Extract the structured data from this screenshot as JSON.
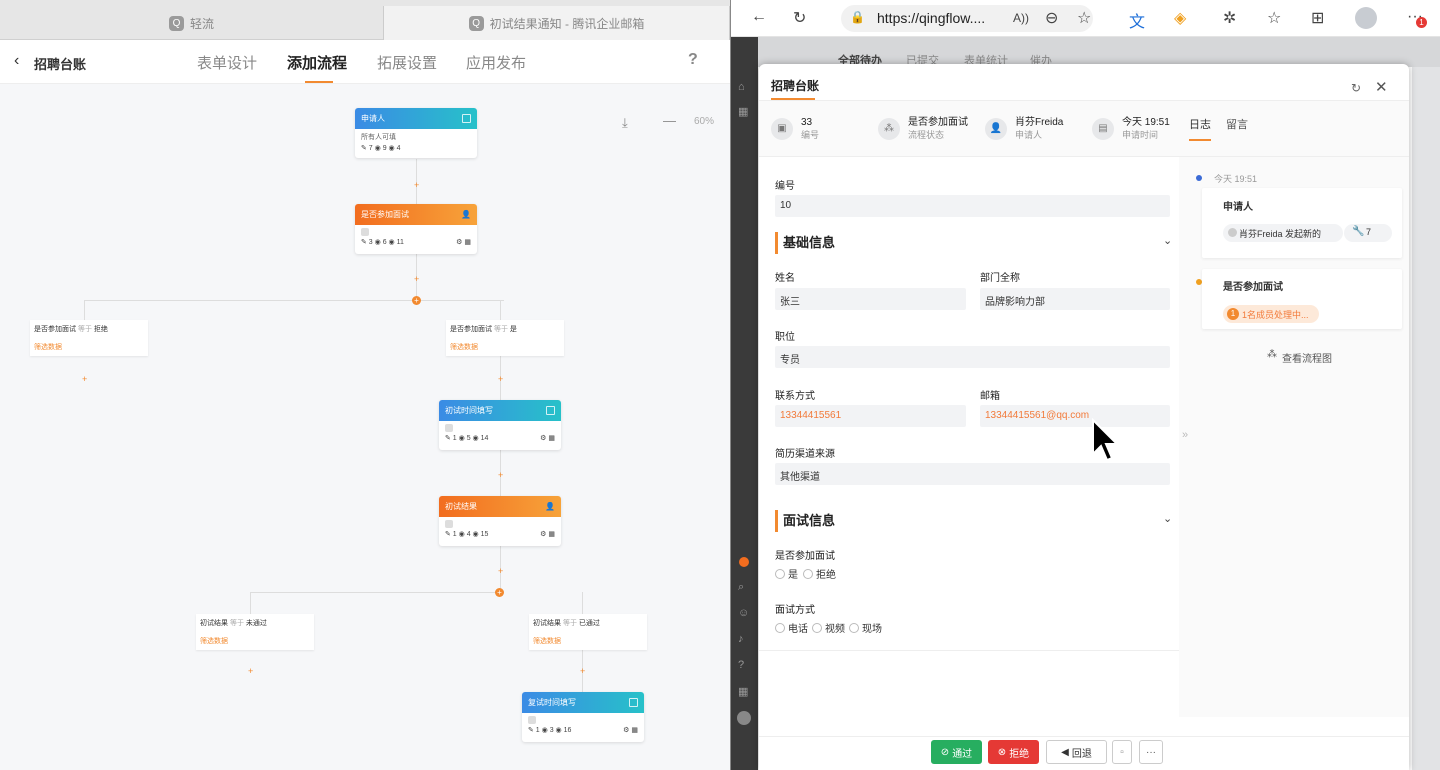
{
  "left_window": {
    "browser_tabs": [
      {
        "icon": "Q",
        "label": "轻流"
      },
      {
        "icon": "Q",
        "label": "初试结果通知 - 腾讯企业邮箱"
      }
    ],
    "app_title": "招聘台账",
    "nav_tabs": [
      "表单设计",
      "添加流程",
      "拓展设置",
      "应用发布"
    ],
    "active_tab": "添加流程",
    "help": "?",
    "zoom": "60%",
    "flow": {
      "n1": {
        "title": "申请人",
        "sub": "所有人可填",
        "stats": "✎ 7 ◉ 9 ◉ 4"
      },
      "n2": {
        "title": "是否参加面试",
        "stats": "✎ 3 ◉ 6 ◉ 11"
      },
      "c1": {
        "title": "是否参加面试",
        "op": "等于",
        "val": "拒绝",
        "filter": "筛选数据"
      },
      "c2": {
        "title": "是否参加面试",
        "op": "等于",
        "val": "是",
        "filter": "筛选数据"
      },
      "n3": {
        "title": "初试时间填写",
        "stats": "✎ 1 ◉ 5 ◉ 14"
      },
      "n4": {
        "title": "初试结果",
        "stats": "✎ 1 ◉ 4 ◉ 15"
      },
      "c3": {
        "title": "初试结果",
        "op": "等于",
        "val": "未通过",
        "filter": "筛选数据"
      },
      "c4": {
        "title": "初试结果",
        "op": "等于",
        "val": "已通过",
        "filter": "筛选数据"
      },
      "n5": {
        "title": "复试时间填写",
        "stats": "✎ 1 ◉ 3 ◉ 16"
      }
    }
  },
  "browser": {
    "url": "https://qingflow....",
    "bg_tabs": [
      "全部待办",
      "已提交",
      "表单统计",
      "催办"
    ]
  },
  "modal": {
    "title": "招聘台账",
    "info": [
      {
        "value": "33",
        "label": "编号"
      },
      {
        "value": "是否参加面试",
        "label": "流程状态"
      },
      {
        "value": "肖芬Freida",
        "label": "申请人"
      },
      {
        "value": "今天 19:51",
        "label": "申请时间"
      }
    ],
    "right_tabs": [
      "日志",
      "留言"
    ],
    "fields": {
      "id_label": "编号",
      "id_value": "10",
      "section1": "基础信息",
      "name_label": "姓名",
      "name_value": "张三",
      "dept_label": "部门全称",
      "dept_value": "品牌影响力部",
      "pos_label": "职位",
      "pos_value": "专员",
      "phone_label": "联系方式",
      "phone_value": "13344415561",
      "email_label": "邮箱",
      "email_value": "13344415561@qq.com",
      "source_label": "简历渠道来源",
      "source_value": "其他渠道",
      "section2": "面试信息",
      "attend_label": "是否参加面试",
      "attend_options": [
        "是",
        "拒绝"
      ],
      "method_label": "面试方式",
      "method_options": [
        "电话",
        "视频",
        "现场"
      ]
    },
    "log": {
      "time": "今天 19:51",
      "step1": "申请人",
      "step1_text": "肖芬Freida 发起新的",
      "step1_count": "7",
      "step2": "是否参加面试",
      "step2_badge_num": "1",
      "step2_badge": "1名成员处理中...",
      "view_flow": "查看流程图"
    },
    "actions": {
      "pass": "通过",
      "reject": "拒绝",
      "back": "回退",
      "more": "···"
    }
  },
  "colors": {
    "accent": "#f28a30",
    "pass": "#27ae60",
    "reject": "#e53935"
  }
}
